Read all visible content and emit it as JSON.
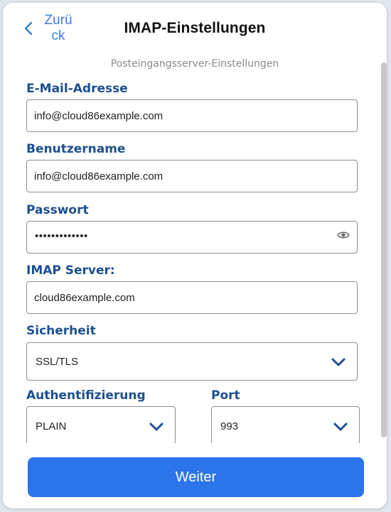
{
  "header": {
    "back_label": "Zurück",
    "title": "IMAP-Einstellungen"
  },
  "subtitle": "Posteingangsserver-Einstellungen",
  "form": {
    "email": {
      "label": "E-Mail-Adresse",
      "value": "info@cloud86example.com"
    },
    "username": {
      "label": "Benutzername",
      "value": "info@cloud86example.com"
    },
    "password": {
      "label": "Passwort",
      "value": "•••••••••••••"
    },
    "imap_server": {
      "label": "IMAP Server:",
      "value": "cloud86example.com"
    },
    "security": {
      "label": "Sicherheit",
      "value": "SSL/TLS"
    },
    "auth": {
      "label": "Authentifizierung",
      "value": "PLAIN"
    },
    "port": {
      "label": "Port",
      "value": "993"
    }
  },
  "footer": {
    "next_label": "Weiter"
  },
  "icons": {
    "back": "chevron-left-icon",
    "eye": "eye-icon",
    "select": "chevron-down-icon"
  },
  "colors": {
    "accent": "#2b74ea",
    "label": "#1d4f91",
    "link": "#3d7dd8"
  }
}
